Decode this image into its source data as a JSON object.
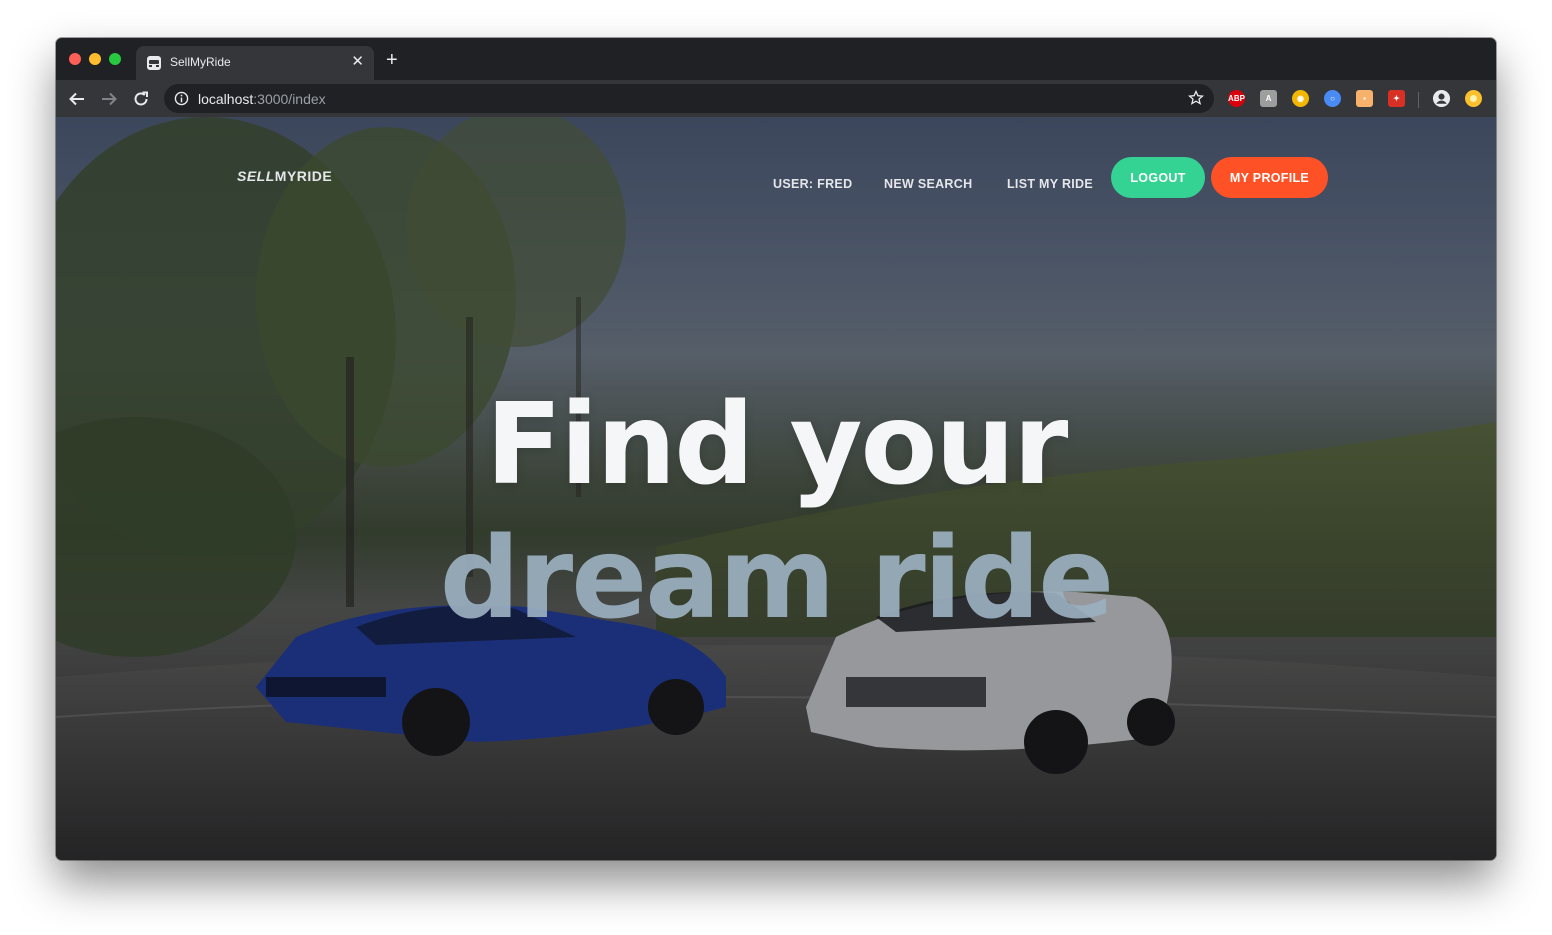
{
  "browser": {
    "tab_title": "SellMyRide",
    "url_host": "localhost",
    "url_rest": ":3000/index",
    "extensions": [
      "adblock-plus-icon",
      "extension-icon",
      "extension-icon",
      "extension-icon",
      "extension-icon",
      "extension-icon"
    ]
  },
  "nav": {
    "brand_part1": "SELL",
    "brand_part2": "MYRIDE",
    "user": "USER: FRED",
    "new_search": "NEW SEARCH",
    "list_my_ride": "LIST MY RIDE",
    "logout": "LOGOUT",
    "my_profile": "MY PROFILE"
  },
  "hero": {
    "line1": "Find your",
    "line2": "dream ride"
  },
  "colors": {
    "logout_bg": "#34d393",
    "profile_bg": "#ff5126"
  }
}
